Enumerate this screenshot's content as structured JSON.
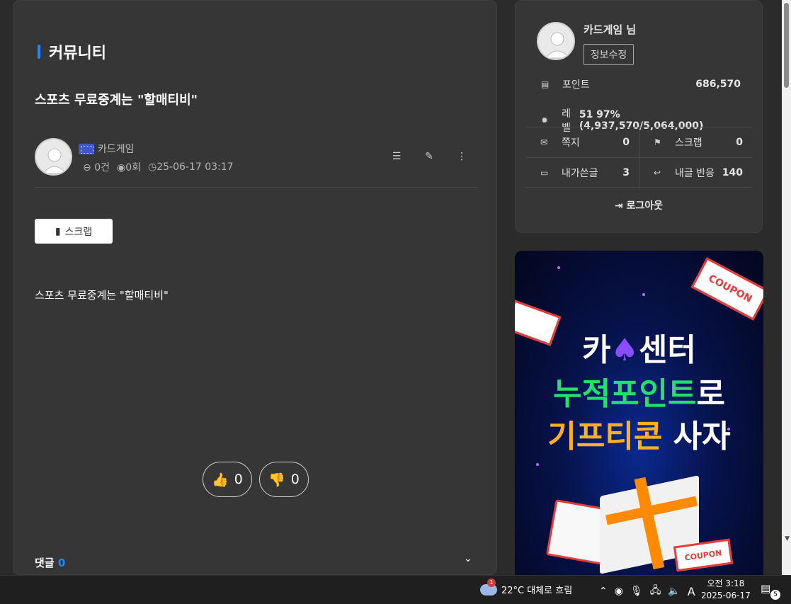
{
  "main": {
    "section_title": "커뮤니티",
    "post_title": "스포츠 무료중계는 \"할매티비\"",
    "author": {
      "name": "카드게임",
      "comments": "0건",
      "views": "0회",
      "date": "25-06-17 03:17"
    },
    "scrap_label": "스크랩",
    "body": "스포츠 무료중계는 \"할매티비\"",
    "likes": "0",
    "dislikes": "0",
    "comments_label": "댓글",
    "comments_count": "0"
  },
  "sidebar": {
    "username": "카드게임 님",
    "edit_label": "정보수정",
    "points_label": "포인트",
    "points": "686,570",
    "level_label": "레벨",
    "level_value": "51 97% (4,937,570/5,064,000)",
    "memo_label": "쪽지",
    "memo": "0",
    "scrap_label": "스크랩",
    "scrap": "0",
    "my_posts_label": "내가쓴글",
    "my_posts": "3",
    "reactions_label": "내글 반응",
    "reactions": "140",
    "logout_label": "로그아웃"
  },
  "banner": {
    "line1_a": "카",
    "line1_b": "센터",
    "line2_a": "누적포인트",
    "line2_b": "로",
    "line3_a": "기프티콘",
    "line3_b": "사자",
    "coupon": "COUPON"
  },
  "taskbar": {
    "weather_badge": "1",
    "weather": "22°C  대체로 흐림",
    "ime": "A",
    "time": "오전 3:18",
    "date": "2025-06-17",
    "notifications": "5"
  },
  "colors": {
    "accent": "#1c88ff",
    "panel": "#363636",
    "background": "#2b2b2b"
  },
  "icons": [
    "list-icon",
    "pencil-icon",
    "more-icon",
    "bookmark-icon",
    "thumbs-up-icon",
    "thumbs-down-icon",
    "chevron-down-icon",
    "mail-icon",
    "flag-icon",
    "reply-icon",
    "logout-icon"
  ]
}
